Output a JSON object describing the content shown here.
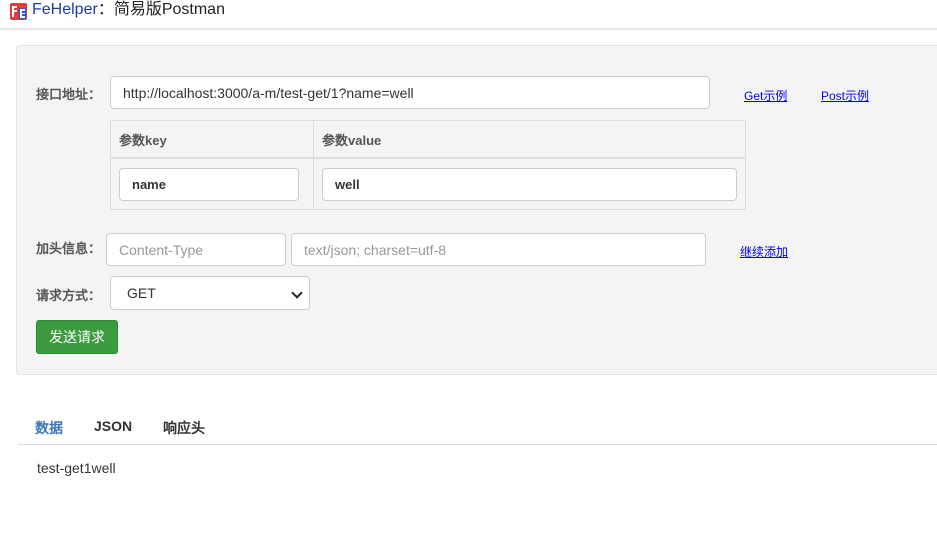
{
  "header": {
    "app_name": "FeHelper",
    "separator": "：",
    "subtitle": "简易版Postman",
    "logo_icon": "fehelper-logo-icon",
    "colors": {
      "logo_red": "#e53935",
      "logo_blue": "#1e5bd6",
      "title_blue": "#1a3ca8"
    }
  },
  "request": {
    "url_label": "接口地址：",
    "url_value": "http://localhost:3000/a-m/test-get/1?name=well",
    "get_example_label": "Get示例",
    "post_example_label": "Post示例",
    "params": {
      "headers": [
        "参数key",
        "参数value"
      ],
      "rows": [
        {
          "key": "name",
          "value": "well"
        }
      ]
    },
    "header_label": "加头信息：",
    "header_key_placeholder": "Content-Type",
    "header_value_placeholder": "text/json; charset=utf-8",
    "add_more_label": "继续添加",
    "method_label": "请求方式：",
    "method_selected": "GET",
    "send_label": "发送请求",
    "colors": {
      "send_button": "#3d9b3f",
      "link": "#0000ee"
    }
  },
  "response": {
    "tabs": [
      {
        "label": "数据",
        "active": true
      },
      {
        "label": "JSON",
        "active": false
      },
      {
        "label": "响应头",
        "active": false
      }
    ],
    "body": "test-get1well",
    "colors": {
      "active_tab": "#3d78b5"
    }
  }
}
